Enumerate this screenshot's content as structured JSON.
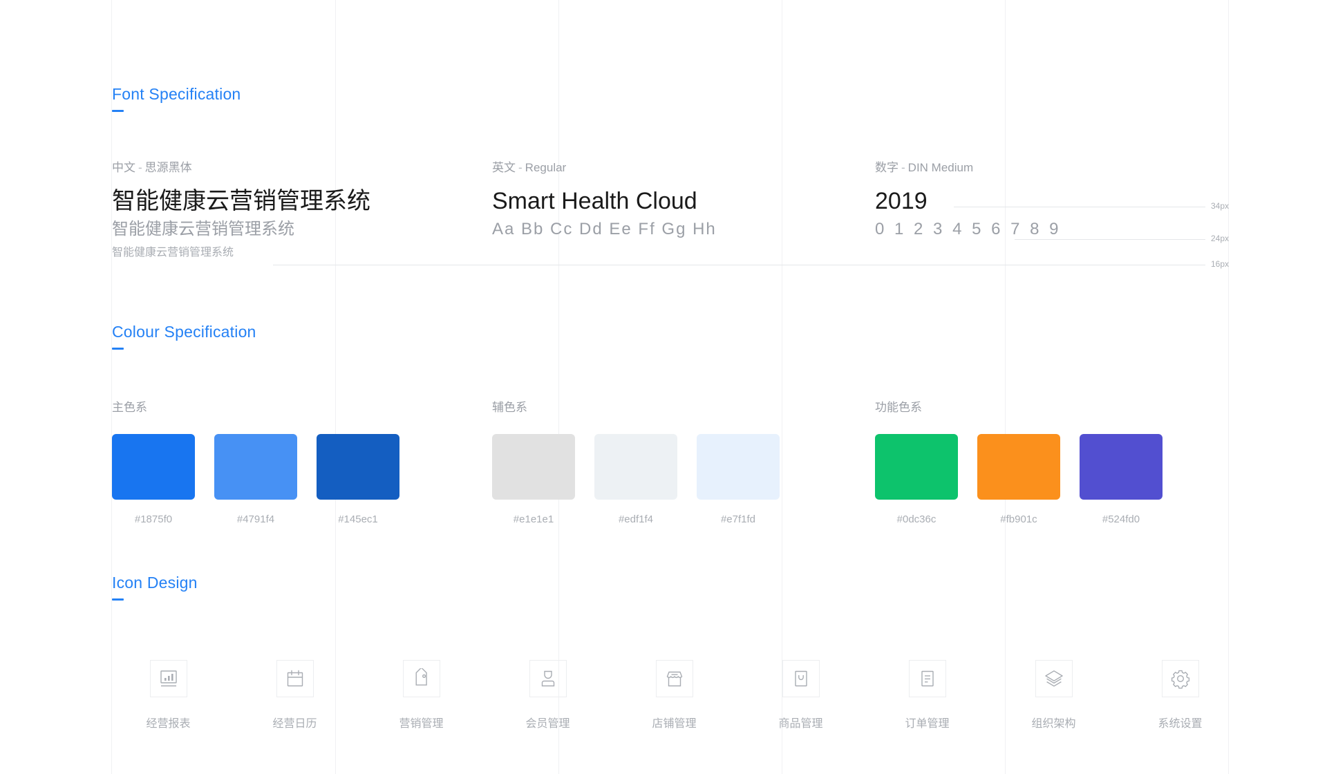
{
  "sections": {
    "font": {
      "title": "Font Specification"
    },
    "colour": {
      "title": "Colour Specification"
    },
    "icon": {
      "title": "Icon Design"
    }
  },
  "font_spec": {
    "chinese": {
      "label_lang": "中文",
      "separator": "-",
      "label_font": "思源黑体",
      "sample_34": "智能健康云营销管理系统",
      "sample_24": "智能健康云营销管理系统",
      "sample_16": "智能健康云营销管理系统"
    },
    "english": {
      "label_lang": "英文",
      "separator": "-",
      "label_font": "Regular",
      "sample_34": "Smart Health Cloud",
      "sample_24": "Aa  Bb  Cc  Dd  Ee  Ff  Gg  Hh"
    },
    "numeric": {
      "label_lang": "数字",
      "separator": "-",
      "label_font": "DIN Medium",
      "sample_34": "2019",
      "sample_24": "0 1 2 3 4 5 6 7 8 9"
    },
    "sizes": [
      {
        "label": "34px"
      },
      {
        "label": "24px"
      },
      {
        "label": "16px"
      }
    ]
  },
  "colour_spec": {
    "groups": [
      {
        "name": "主色系",
        "swatches": [
          {
            "hex": "#1875f0"
          },
          {
            "hex": "#4791f4"
          },
          {
            "hex": "#145ec1"
          }
        ]
      },
      {
        "name": "辅色系",
        "swatches": [
          {
            "hex": "#e1e1e1"
          },
          {
            "hex": "#edf1f4"
          },
          {
            "hex": "#e7f1fd"
          }
        ]
      },
      {
        "name": "功能色系",
        "swatches": [
          {
            "hex": "#0dc36c"
          },
          {
            "hex": "#fb901c"
          },
          {
            "hex": "#524fd0"
          }
        ]
      }
    ]
  },
  "icon_design": {
    "icons": [
      {
        "label": "经营报表",
        "icon": "bar-chart-icon"
      },
      {
        "label": "经营日历",
        "icon": "calendar-icon"
      },
      {
        "label": "营销管理",
        "icon": "tag-icon"
      },
      {
        "label": "会员管理",
        "icon": "user-icon"
      },
      {
        "label": "店铺管理",
        "icon": "shop-icon"
      },
      {
        "label": "商品管理",
        "icon": "product-box-icon"
      },
      {
        "label": "订单管理",
        "icon": "order-document-icon"
      },
      {
        "label": "组织架构",
        "icon": "layers-icon"
      },
      {
        "label": "系统设置",
        "icon": "gear-icon"
      }
    ]
  },
  "theme": {
    "accent": "#2481f5",
    "grid_line": "#f0f1f3",
    "muted_text": "#9b9fa6"
  }
}
